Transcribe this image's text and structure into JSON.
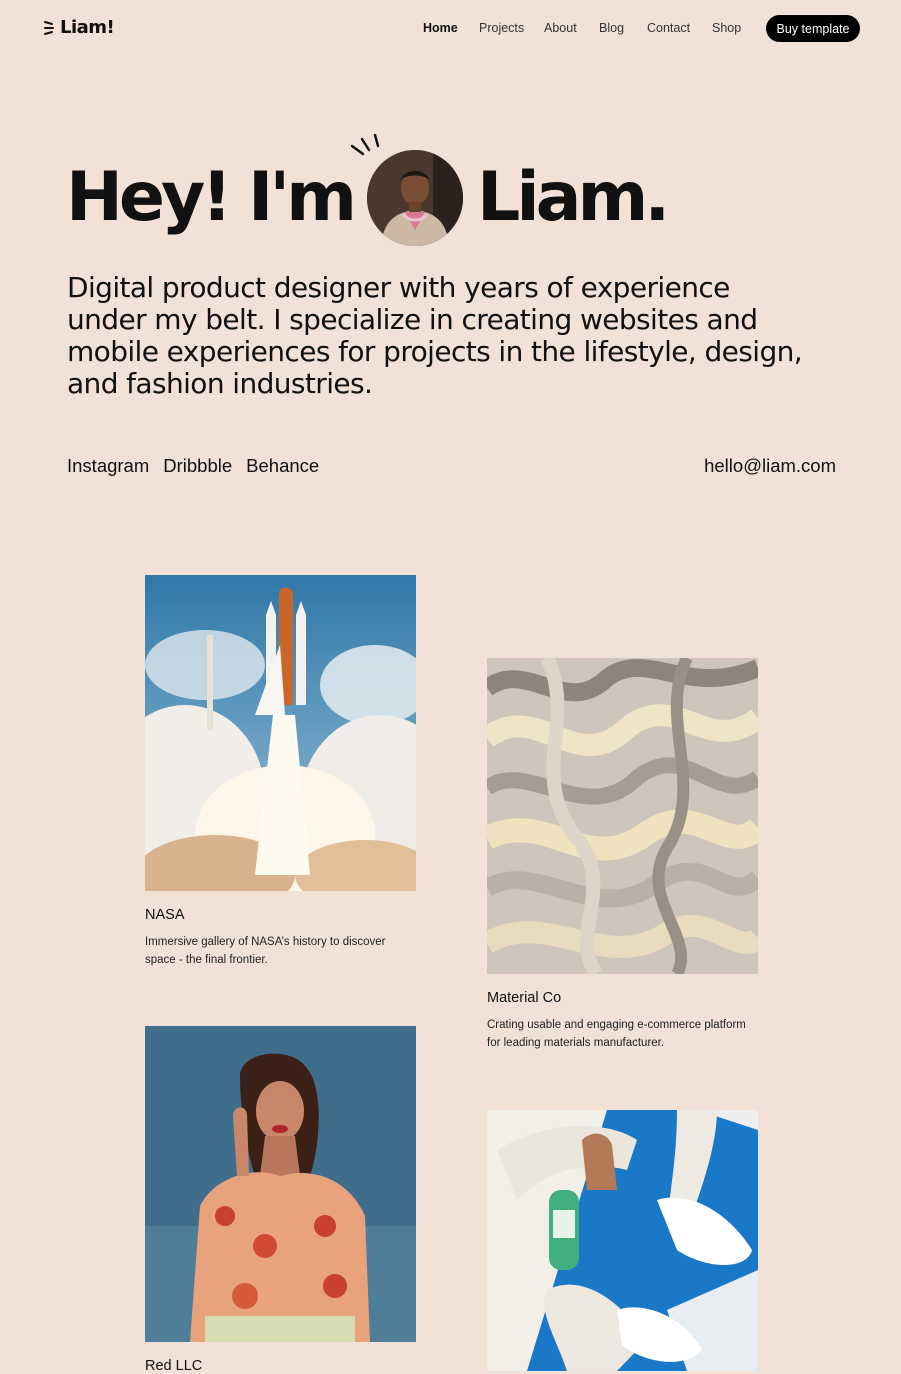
{
  "header": {
    "logo": "Liam!",
    "nav": [
      "Home",
      "Projects",
      "About",
      "Blog",
      "Contact",
      "Shop"
    ],
    "cta": "Buy template"
  },
  "hero": {
    "title_before": "Hey! I'm",
    "title_after": "Liam.",
    "intro": "Digital product designer with years of experience under my belt. I specialize in creating websites and mobile experiences for projects in the lifestyle, design, and fashion industries."
  },
  "links": {
    "social": [
      "Instagram",
      "Dribbble",
      "Behance"
    ],
    "email": "hello@liam.com"
  },
  "projects": [
    {
      "title": "NASA",
      "description": "Immersive gallery of NASA’s history to discover space - the final frontier."
    },
    {
      "title": "Material Co",
      "description": "Crating usable and engaging e-commerce platform for leading materials manufacturer."
    },
    {
      "title": "Red LLC",
      "description": ""
    },
    {
      "title": "",
      "description": ""
    }
  ]
}
